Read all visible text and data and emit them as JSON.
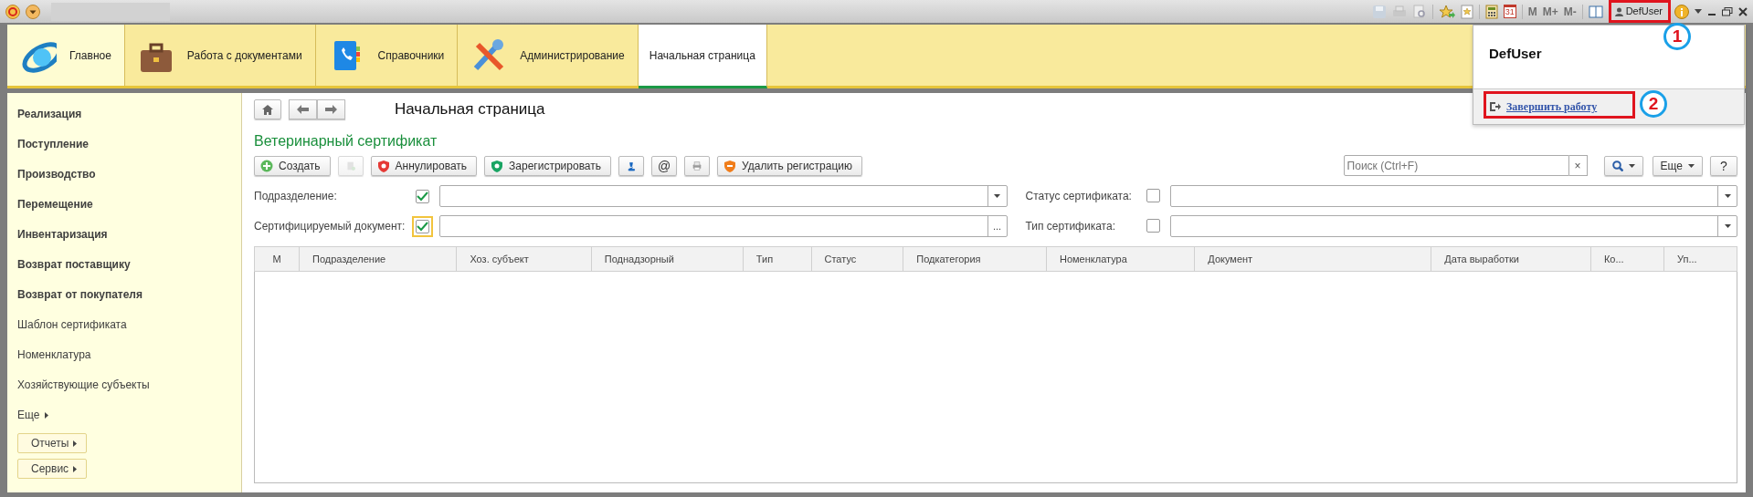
{
  "titlebar": {
    "memory_buttons": [
      "M",
      "M+",
      "M-"
    ],
    "calendar_day": "31",
    "user": "DefUser"
  },
  "sections": [
    {
      "kind": "section",
      "label": "Главное",
      "selected": false
    },
    {
      "kind": "section",
      "label": "Работа с документами",
      "selected": false
    },
    {
      "kind": "section",
      "label": "Справочники",
      "selected": false
    },
    {
      "kind": "section",
      "label": "Администрирование",
      "selected": false
    },
    {
      "kind": "page",
      "label": "Начальная страница",
      "selected": true
    }
  ],
  "sidebar": {
    "items": [
      {
        "label": "Реализация",
        "bold": true
      },
      {
        "label": "Поступление",
        "bold": true
      },
      {
        "label": "Производство",
        "bold": true
      },
      {
        "label": "Перемещение",
        "bold": true
      },
      {
        "label": "Инвентаризация",
        "bold": true
      },
      {
        "label": "Возврат поставщику",
        "bold": true
      },
      {
        "label": "Возврат от покупателя",
        "bold": true
      },
      {
        "label": "Шаблон сертификата",
        "bold": false
      },
      {
        "label": "Номенклатура",
        "bold": false
      },
      {
        "label": "Хозяйствующие субъекты",
        "bold": false
      }
    ],
    "more": "Еще",
    "buttons": [
      "Отчеты",
      "Сервис"
    ]
  },
  "page": {
    "title": "Начальная страница",
    "form_title": "Ветеринарный сертификат"
  },
  "toolbar": [
    {
      "kind": "labeled",
      "label": "Создать",
      "disabled": false
    },
    {
      "kind": "icon",
      "disabled": true
    },
    {
      "kind": "labeled",
      "label": "Аннулировать",
      "disabled": false
    },
    {
      "kind": "labeled",
      "label": "Зарегистрировать",
      "disabled": false
    },
    {
      "kind": "icon",
      "disabled": false
    },
    {
      "kind": "text",
      "label": "@",
      "disabled": false
    },
    {
      "kind": "icon",
      "disabled": false
    },
    {
      "kind": "labeled",
      "label": "Удалить регистрацию",
      "disabled": false
    }
  ],
  "search": {
    "placeholder": "Поиск (Ctrl+F)",
    "clear": "×",
    "more": "Еще",
    "help": "?"
  },
  "filters": [
    {
      "kind": "select",
      "label": "Подразделение:",
      "checked": true,
      "focused": false
    },
    {
      "kind": "select",
      "label": "Статус сертификата:",
      "checked": false,
      "focused": false
    },
    {
      "kind": "choice",
      "label": "Сертифицируемый документ:",
      "checked": true,
      "focused": true,
      "button": "..."
    },
    {
      "kind": "select",
      "label": "Тип сертификата:",
      "checked": false,
      "focused": false
    }
  ],
  "table": {
    "columns": [
      "М",
      "Подразделение",
      "Хоз. субъект",
      "Поднадзорный",
      "Тип",
      "Статус",
      "Подкатегория",
      "Номенклатура",
      "Документ",
      "Дата выработки",
      "Ко...",
      "Уп..."
    ]
  },
  "user_menu": {
    "name": "DefUser",
    "link": "Завершить работу"
  },
  "annotations": [
    {
      "number": "1"
    },
    {
      "number": "2"
    }
  ]
}
